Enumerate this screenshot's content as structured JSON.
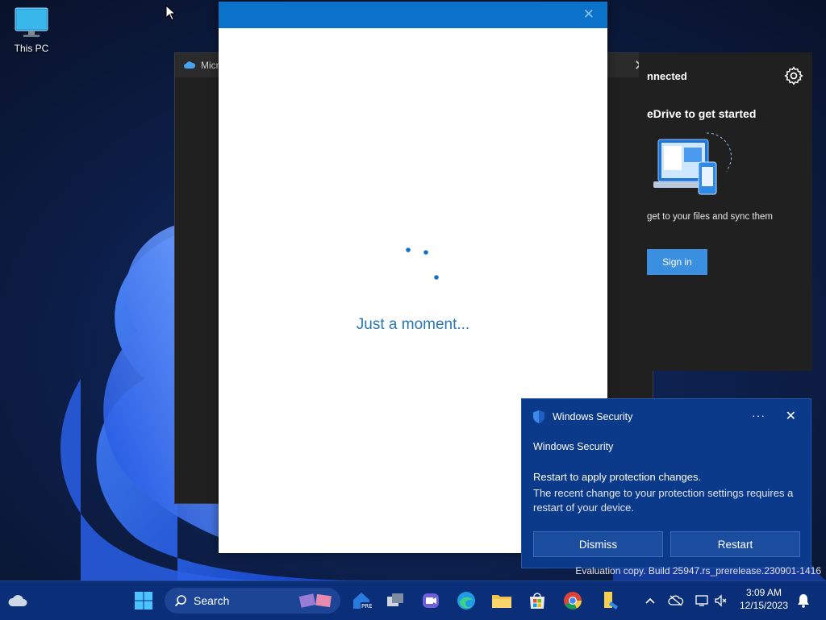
{
  "desktop": {
    "icons": [
      {
        "label": "This PC"
      }
    ]
  },
  "onedrive_window": {
    "title": "Micro",
    "panel": {
      "status": "nnected",
      "heading": "eDrive to get started",
      "description": "get to your files and sync them",
      "signin_label": "Sign in"
    }
  },
  "signin_dialog": {
    "loading_text": "Just a moment..."
  },
  "toast": {
    "app_name": "Windows Security",
    "subtitle": "Windows Security",
    "headline": "Restart to apply protection changes.",
    "body": "The recent change to your protection settings requires a restart of your device.",
    "dismiss_label": "Dismiss",
    "restart_label": "Restart",
    "more_label": "···",
    "close_label": "✕"
  },
  "watermark": "Evaluation copy. Build 25947.rs_prerelease.230901-1416",
  "taskbar": {
    "search_label": "Search",
    "time": "3:09 AM",
    "date": "12/15/2023"
  },
  "colors": {
    "accent": "#0a73c9",
    "toast_bg": "#0c3a8a",
    "taskbar_bg": "#0a2f78",
    "loading_text": "#2878b7"
  }
}
